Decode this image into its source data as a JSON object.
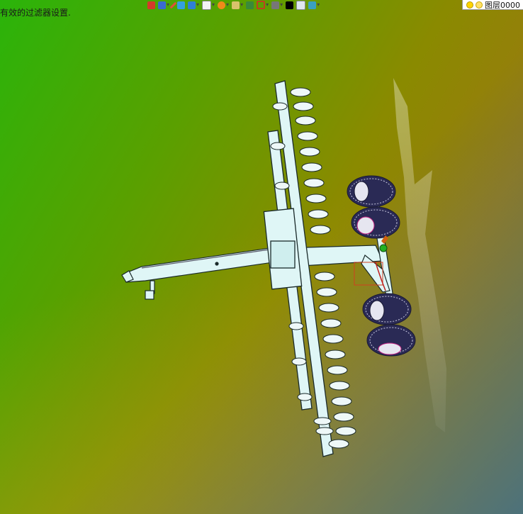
{
  "status": {
    "message": "有效的过滤器设置."
  },
  "toolbar": {
    "buttons": [
      {
        "name": "exit-icon",
        "color": "#d33a2a",
        "dropdown": false
      },
      {
        "name": "render-mode-icon",
        "color": "#3a6ad0",
        "dropdown": true
      },
      {
        "name": "pen-icon",
        "color": "#e0503a",
        "dropdown": false
      },
      {
        "name": "material-icon",
        "color": "#33a0e0",
        "dropdown": false
      },
      {
        "name": "cube-icon",
        "color": "#2f7fd6",
        "dropdown": true
      },
      {
        "name": "view-cube-icon",
        "color": "#f4f4f4",
        "dropdown": true
      },
      {
        "name": "dial-icon",
        "color": "#f08a1a",
        "dropdown": true
      },
      {
        "name": "lamp-icon",
        "color": "#d9c26a",
        "dropdown": true
      },
      {
        "name": "note-icon",
        "color": "#3a8a3a",
        "dropdown": false
      },
      {
        "name": "frame-icon",
        "color": "#c04020",
        "dropdown": true
      },
      {
        "name": "printer-icon",
        "color": "#777777",
        "dropdown": true
      },
      {
        "name": "color-swatch-icon",
        "color": "#000000",
        "dropdown": false
      },
      {
        "name": "page-icon",
        "color": "#dfe7ee",
        "dropdown": false
      },
      {
        "name": "layers-icon",
        "color": "#3aa0c0",
        "dropdown": true
      }
    ],
    "layer": {
      "value": "图层0000"
    }
  },
  "colors": {
    "machine": "#dff6f6",
    "machine_edge": "#1a2a2a",
    "tire": "#2a2a55",
    "tire_rim": "#e6e6f0",
    "accent_green": "#22b022",
    "accent_orange": "#d06010"
  }
}
